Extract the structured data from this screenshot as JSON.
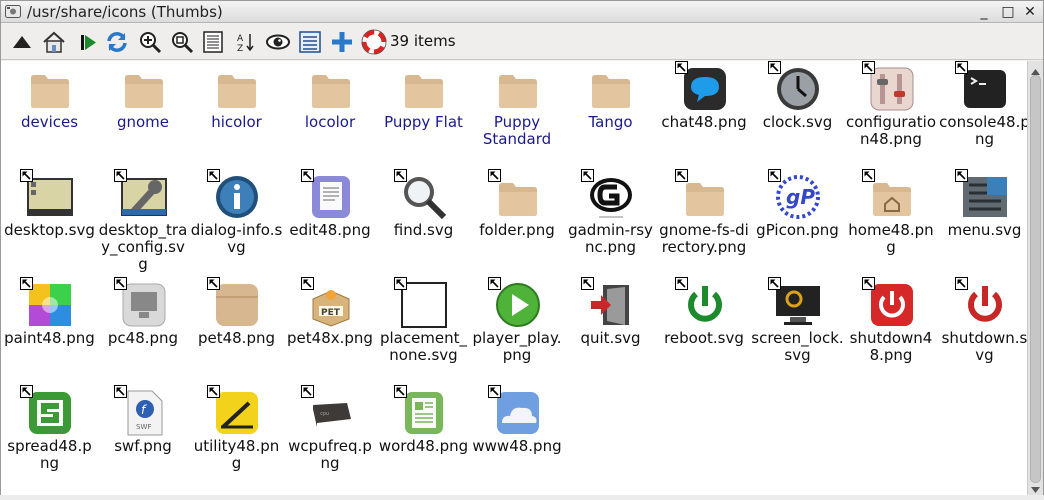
{
  "window": {
    "title": "/usr/share/icons (Thumbs)",
    "app_icon": "rox-filer-icon",
    "buttons": [
      "minimize-icon",
      "maximize-icon",
      "close-icon"
    ],
    "controls": {
      "minimize": "_",
      "maximize": "□",
      "close": "✕"
    }
  },
  "toolbar": {
    "buttons": [
      "up-icon",
      "home-icon",
      "run-icon",
      "refresh-icon",
      "zoom-in-icon",
      "zoom-fit-icon",
      "details-icon",
      "sort-icon",
      "show-hidden-icon",
      "select-icon",
      "new-icon",
      "help-icon"
    ],
    "item_count": "39 items"
  },
  "colors": {
    "folder": "#d8b890",
    "dir_label": "#1a1a8c"
  },
  "items": [
    {
      "label": "devices",
      "type": "folder"
    },
    {
      "label": "gnome",
      "type": "folder"
    },
    {
      "label": "hicolor",
      "type": "folder"
    },
    {
      "label": "locolor",
      "type": "folder"
    },
    {
      "label": "Puppy Flat",
      "type": "folder"
    },
    {
      "label": "Puppy Standard",
      "type": "folder"
    },
    {
      "label": "Tango",
      "type": "folder"
    },
    {
      "label": "chat48.png",
      "type": "file",
      "icon": "chat-icon"
    },
    {
      "label": "clock.svg",
      "type": "file",
      "icon": "clock-icon"
    },
    {
      "label": "configuration48.png",
      "type": "file",
      "icon": "configuration-icon"
    },
    {
      "label": "console48.png",
      "type": "file",
      "icon": "console-icon"
    },
    {
      "label": "desktop.svg",
      "type": "file",
      "icon": "desktop-icon"
    },
    {
      "label": "desktop_tray_config.svg",
      "type": "file",
      "icon": "desktop-tray-config-icon"
    },
    {
      "label": "dialog-info.svg",
      "type": "file",
      "icon": "dialog-info-icon"
    },
    {
      "label": "edit48.png",
      "type": "file",
      "icon": "edit-icon"
    },
    {
      "label": "find.svg",
      "type": "file",
      "icon": "find-icon"
    },
    {
      "label": "folder.png",
      "type": "file",
      "icon": "folder-icon"
    },
    {
      "label": "gadmin-rsync.png",
      "type": "file",
      "icon": "gadmin-rsync-icon"
    },
    {
      "label": "gnome-fs-directory.png",
      "type": "file",
      "icon": "gnome-fs-directory-icon"
    },
    {
      "label": "gPicon.png",
      "type": "file",
      "icon": "gpicon-icon"
    },
    {
      "label": "home48.png",
      "type": "file",
      "icon": "home-folder-icon"
    },
    {
      "label": "menu.svg",
      "type": "file",
      "icon": "menu-icon"
    },
    {
      "label": "paint48.png",
      "type": "file",
      "icon": "paint-icon"
    },
    {
      "label": "pc48.png",
      "type": "file",
      "icon": "pc-icon"
    },
    {
      "label": "pet48.png",
      "type": "file",
      "icon": "pet-icon"
    },
    {
      "label": "pet48x.png",
      "type": "file",
      "icon": "pet-box-icon"
    },
    {
      "label": "placement_none.svg",
      "type": "file",
      "icon": "placement-none-icon"
    },
    {
      "label": "player_play.png",
      "type": "file",
      "icon": "player-play-icon"
    },
    {
      "label": "quit.svg",
      "type": "file",
      "icon": "quit-icon"
    },
    {
      "label": "reboot.svg",
      "type": "file",
      "icon": "reboot-icon"
    },
    {
      "label": "screen_lock.svg",
      "type": "file",
      "icon": "screen-lock-icon"
    },
    {
      "label": "shutdown48.png",
      "type": "file",
      "icon": "shutdown-48-icon"
    },
    {
      "label": "shutdown.svg",
      "type": "file",
      "icon": "shutdown-icon"
    },
    {
      "label": "spread48.png",
      "type": "file",
      "icon": "spread-icon"
    },
    {
      "label": "swf.png",
      "type": "file",
      "icon": "swf-icon"
    },
    {
      "label": "utility48.png",
      "type": "file",
      "icon": "utility-icon"
    },
    {
      "label": "wcpufreq.png",
      "type": "file",
      "icon": "cpu-icon"
    },
    {
      "label": "word48.png",
      "type": "file",
      "icon": "word-icon"
    },
    {
      "label": "www48.png",
      "type": "file",
      "icon": "www-icon"
    }
  ]
}
